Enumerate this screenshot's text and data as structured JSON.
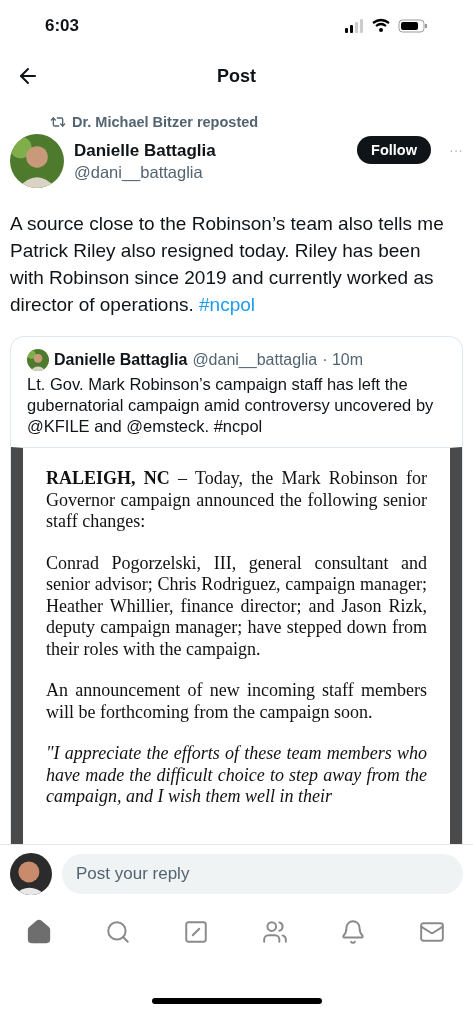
{
  "status_bar": {
    "time": "6:03"
  },
  "header": {
    "title": "Post"
  },
  "repost": {
    "label": "Dr. Michael Bitzer reposted"
  },
  "author": {
    "name": "Danielle Battaglia",
    "handle": "@dani__battaglia",
    "follow": "Follow",
    "more": "···"
  },
  "body": {
    "text": "A source close to the Robinson’s team also tells me Patrick Riley also resigned today. Riley has been  with Robinson since 2019 and currently worked as director of operations.",
    "hashtag": "#ncpol"
  },
  "quote": {
    "name": "Danielle Battaglia",
    "handle": "@dani__battaglia",
    "time": "· 10m",
    "text": "Lt. Gov. Mark Robinson’s campaign staff has left the gubernatorial campaign amid controversy uncovered by @KFILE and @emsteck. #ncpol",
    "document": [
      {
        "kind": "plain",
        "text": "**RALEIGH, NC** – Today, the Mark Robinson for Governor campaign announced the following senior staff changes:"
      },
      {
        "kind": "plain",
        "text": "Conrad Pogorzelski, III, general consultant and senior advisor; Chris Rodriguez, campaign manager; Heather Whillier, finance director; and Jason Rizk, deputy campaign manager; have stepped down from their roles with the campaign."
      },
      {
        "kind": "plain",
        "text": "An announcement of new incoming staff members will be forthcoming from the campaign soon."
      },
      {
        "kind": "italic",
        "text": "\"I appreciate the efforts of these team members who have made the difficult choice to step away from the campaign, and I wish them well in their"
      }
    ]
  },
  "reply": {
    "placeholder": "Post your reply"
  },
  "nav": [
    {
      "kind": "home",
      "selected": true
    },
    {
      "kind": "search",
      "selected": false
    },
    {
      "kind": "compose",
      "selected": false
    },
    {
      "kind": "communities",
      "selected": false
    },
    {
      "kind": "notifications",
      "selected": false
    },
    {
      "kind": "messages",
      "selected": false
    }
  ]
}
